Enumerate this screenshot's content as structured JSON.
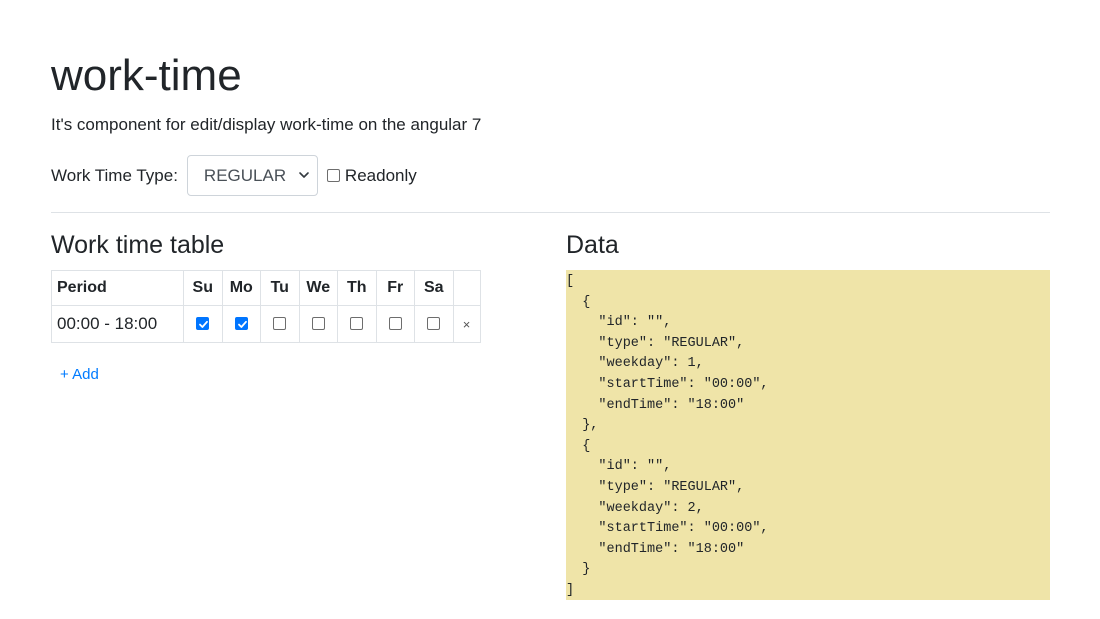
{
  "page": {
    "title": "work-time",
    "subtitle": "It's component for edit/display work-time on the angular 7"
  },
  "controls": {
    "type_label": "Work Time Type:",
    "type_select": {
      "selected": "REGULAR"
    },
    "readonly_label": "Readonly",
    "readonly_checked": false
  },
  "table_section": {
    "heading": "Work time table",
    "columns": [
      "Period",
      "Su",
      "Mo",
      "Tu",
      "We",
      "Th",
      "Fr",
      "Sa"
    ],
    "rows": [
      {
        "period": "00:00 - 18:00",
        "days": [
          true,
          true,
          false,
          false,
          false,
          false,
          false
        ],
        "remove_icon": "close-icon",
        "remove_glyph": "×"
      }
    ],
    "add_label": "+ Add"
  },
  "data_section": {
    "heading": "Data",
    "json_text": "[\n  {\n    \"id\": \"\",\n    \"type\": \"REGULAR\",\n    \"weekday\": 1,\n    \"startTime\": \"00:00\",\n    \"endTime\": \"18:00\"\n  },\n  {\n    \"id\": \"\",\n    \"type\": \"REGULAR\",\n    \"weekday\": 2,\n    \"startTime\": \"00:00\",\n    \"endTime\": \"18:00\"\n  }\n]"
  },
  "colors": {
    "accent": "#0075ff",
    "link": "#007bff",
    "data_background": "#efe4a8"
  }
}
